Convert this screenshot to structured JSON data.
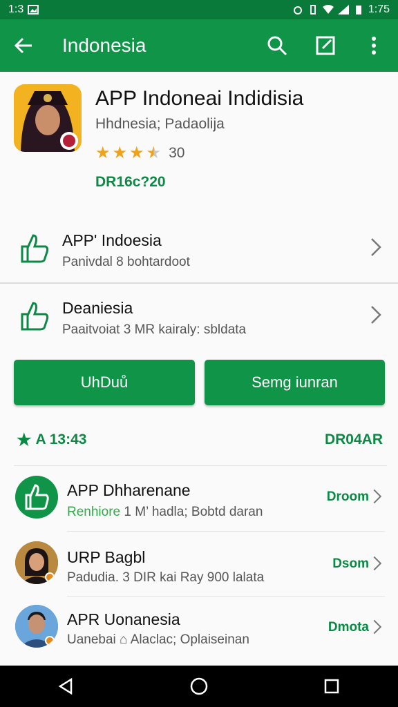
{
  "status_bar": {
    "left_text": "1:3",
    "right_text": "1:75"
  },
  "app_bar": {
    "title": "Indonesia",
    "back_icon": "arrow-back-icon",
    "search_icon": "search-icon",
    "edit_icon": "edit-icon",
    "more_icon": "more-vert-icon"
  },
  "app": {
    "title": "APP Indoneai Indidisia",
    "subtitle": "Hhdnesia; Padaolija",
    "rating_stars": 3.5,
    "rating_count": "30",
    "price": "DR16c?20"
  },
  "rows": [
    {
      "title": "APP' Indoesia",
      "subtitle": "Panivdal  8 bohtardoot",
      "icon": "thumbs-up-icon"
    },
    {
      "title": "Deaniesia",
      "subtitle": "Paaitvoiat 3 MR kairaly: sbldata",
      "icon": "thumbs-up-icon"
    }
  ],
  "buttons": {
    "primary": "UhDuů",
    "secondary": "Semg iunran"
  },
  "section": {
    "left_label": "A 13:43",
    "right_label": "DR04AR"
  },
  "list": [
    {
      "title": "APP Dhharenane",
      "sub_highlight": "Renhiore",
      "subtitle": " 1 M’ hadla; Bobtd daran",
      "action": "Droom"
    },
    {
      "title": "URP Bagbl",
      "sub_highlight": "",
      "subtitle": "Padudia. 3 DIR kai Ray 900 lalata",
      "action": "Dsom"
    },
    {
      "title": "APR Uonanesia",
      "sub_highlight": "",
      "subtitle": "Uanebai ⌂ Alaclac; Oplaiseinan",
      "action": "Dmota"
    }
  ],
  "colors": {
    "primary": "#0f9448",
    "status_bar": "#0a7a3a",
    "accent_text": "#0a8a44",
    "star": "#f0a21a"
  }
}
